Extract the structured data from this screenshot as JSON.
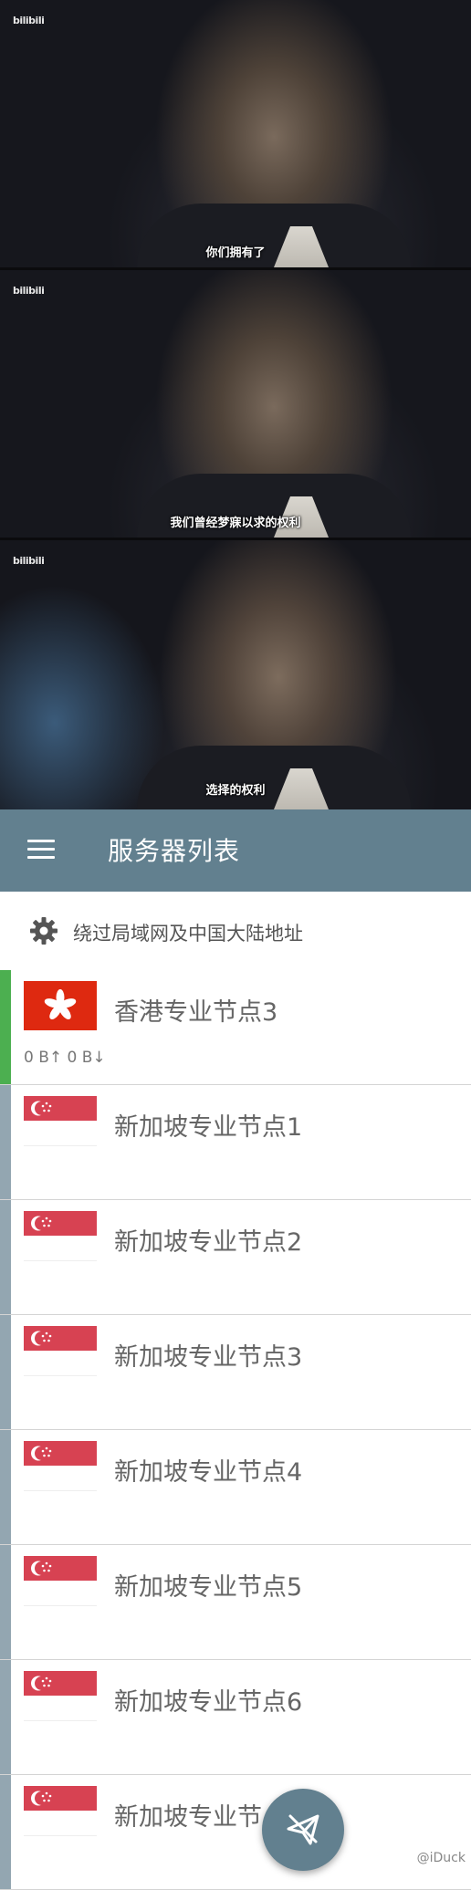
{
  "video": {
    "watermark": "bilibili",
    "frames": [
      {
        "subtitle": "你们拥有了"
      },
      {
        "subtitle": "我们曾经梦寐以求的权利"
      },
      {
        "subtitle": "选择的权利"
      }
    ]
  },
  "app": {
    "title": "服务器列表",
    "bypass_label": "绕过局域网及中国大陆地址",
    "accent_color": "#62808f",
    "active_color": "#4caf50",
    "servers": [
      {
        "name": "香港专业节点3",
        "flag": "hong-kong-flag",
        "traffic": "0 B↑ 0 B↓",
        "active": true
      },
      {
        "name": "新加坡专业节点1",
        "flag": "singapore-flag"
      },
      {
        "name": "新加坡专业节点2",
        "flag": "singapore-flag"
      },
      {
        "name": "新加坡专业节点3",
        "flag": "singapore-flag"
      },
      {
        "name": "新加坡专业节点4",
        "flag": "singapore-flag"
      },
      {
        "name": "新加坡专业节点5",
        "flag": "singapore-flag"
      },
      {
        "name": "新加坡专业节点6",
        "flag": "singapore-flag"
      },
      {
        "name": "新加坡专业节点7",
        "flag": "singapore-flag"
      }
    ]
  },
  "weibo_watermark": "@iDuck"
}
